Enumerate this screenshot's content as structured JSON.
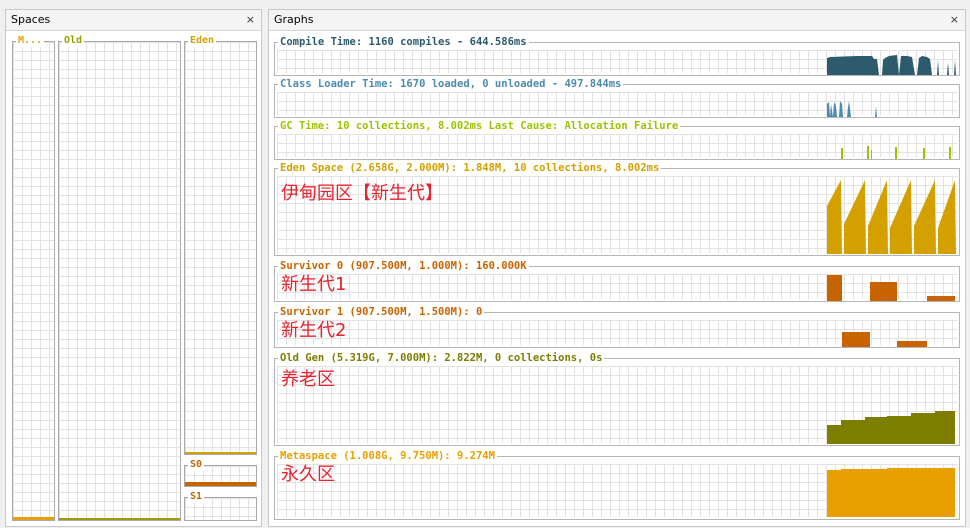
{
  "spaces_panel": {
    "title": "Spaces",
    "close": "×",
    "metaspace": {
      "title": "M...",
      "color": "#e89f00",
      "fill_fraction": 0.006
    },
    "old": {
      "title": "Old",
      "color": "#9c9c00",
      "fill_fraction": 0.004
    },
    "eden": {
      "title": "Eden",
      "color": "#d4a000",
      "fill_fraction": 0.004
    },
    "s0": {
      "title": "S0",
      "color": "#c86400",
      "fill_fraction": 0.2
    },
    "s1": {
      "title": "S1",
      "color": "#c86400",
      "fill_fraction": 0
    }
  },
  "graphs_panel": {
    "title": "Graphs",
    "close": "×",
    "compile": {
      "title": "Compile Time: 1160 compiles - 644.586ms",
      "color": "#2e5a6e"
    },
    "classloader": {
      "title": "Class Loader Time: 1670 loaded, 0 unloaded - 497.844ms",
      "color": "#4d8ab0"
    },
    "gc": {
      "title": "GC Time: 10 collections, 8.002ms Last Cause: Allocation Failure",
      "color": "#9ac300"
    },
    "eden": {
      "title": "Eden Space (2.658G, 2.000M): 1.848M, 10 collections, 8.002ms",
      "color": "#d4a000",
      "note": "伊甸园区【新生代】"
    },
    "survivor0": {
      "title": "Survivor 0 (907.500M, 1.000M): 160.000K",
      "color": "#c86400",
      "note": "新生代1"
    },
    "survivor1": {
      "title": "Survivor 1 (907.500M, 1.500M): 0",
      "color": "#c86400",
      "note": "新生代2"
    },
    "oldgen": {
      "title": "Old Gen (5.319G, 7.000M): 2.822M, 0 collections, 0s",
      "color": "#7d7d00",
      "note": "养老区"
    },
    "metaspace": {
      "title": "Metaspace (1.008G, 9.750M): 9.274M",
      "color": "#e89f00",
      "note": "永久区"
    }
  }
}
